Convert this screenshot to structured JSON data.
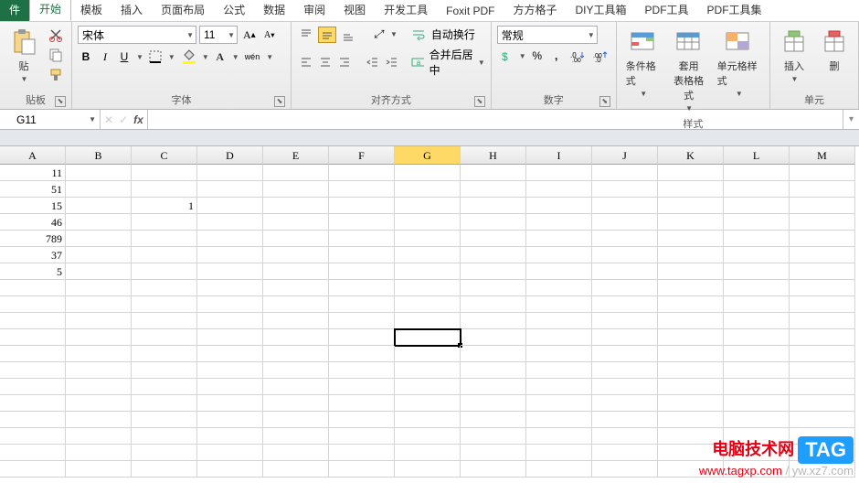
{
  "tabs": [
    "件",
    "开始",
    "模板",
    "插入",
    "页面布局",
    "公式",
    "数据",
    "审阅",
    "视图",
    "开发工具",
    "Foxit PDF",
    "方方格子",
    "DIY工具箱",
    "PDF工具",
    "PDF工具集"
  ],
  "active_tab": 1,
  "clipboard": {
    "paste": "贴",
    "label": "贴板"
  },
  "font": {
    "name": "宋体",
    "size": "11",
    "bold": "B",
    "italic": "I",
    "underline": "U",
    "label": "字体"
  },
  "align": {
    "wrap": "自动换行",
    "merge": "合并后居中",
    "label": "对齐方式"
  },
  "number": {
    "format": "常规",
    "label": "数字"
  },
  "styles": {
    "cond": "条件格式",
    "table": "套用\n表格格式",
    "cell": "单元格样式",
    "label": "样式"
  },
  "cells": {
    "insert": "插入",
    "delete": "删",
    "label": "单元"
  },
  "formula_bar": {
    "cell_ref": "G11",
    "fx": "fx",
    "value": ""
  },
  "columns": [
    "A",
    "B",
    "C",
    "D",
    "E",
    "F",
    "G",
    "H",
    "I",
    "J",
    "K",
    "L",
    "M"
  ],
  "active_col": 6,
  "cell_data": {
    "A1": "11",
    "A2": "51",
    "A3": "15",
    "A4": "46",
    "A5": "789",
    "A6": "37",
    "A7": "5",
    "C3": "1"
  },
  "selected_cell": {
    "row": 11,
    "col": 6
  },
  "watermark": {
    "site1": "电脑技术网",
    "tag": "TAG",
    "url1": "www.tagxp.com",
    "url2": " / yw.xz7.com"
  }
}
